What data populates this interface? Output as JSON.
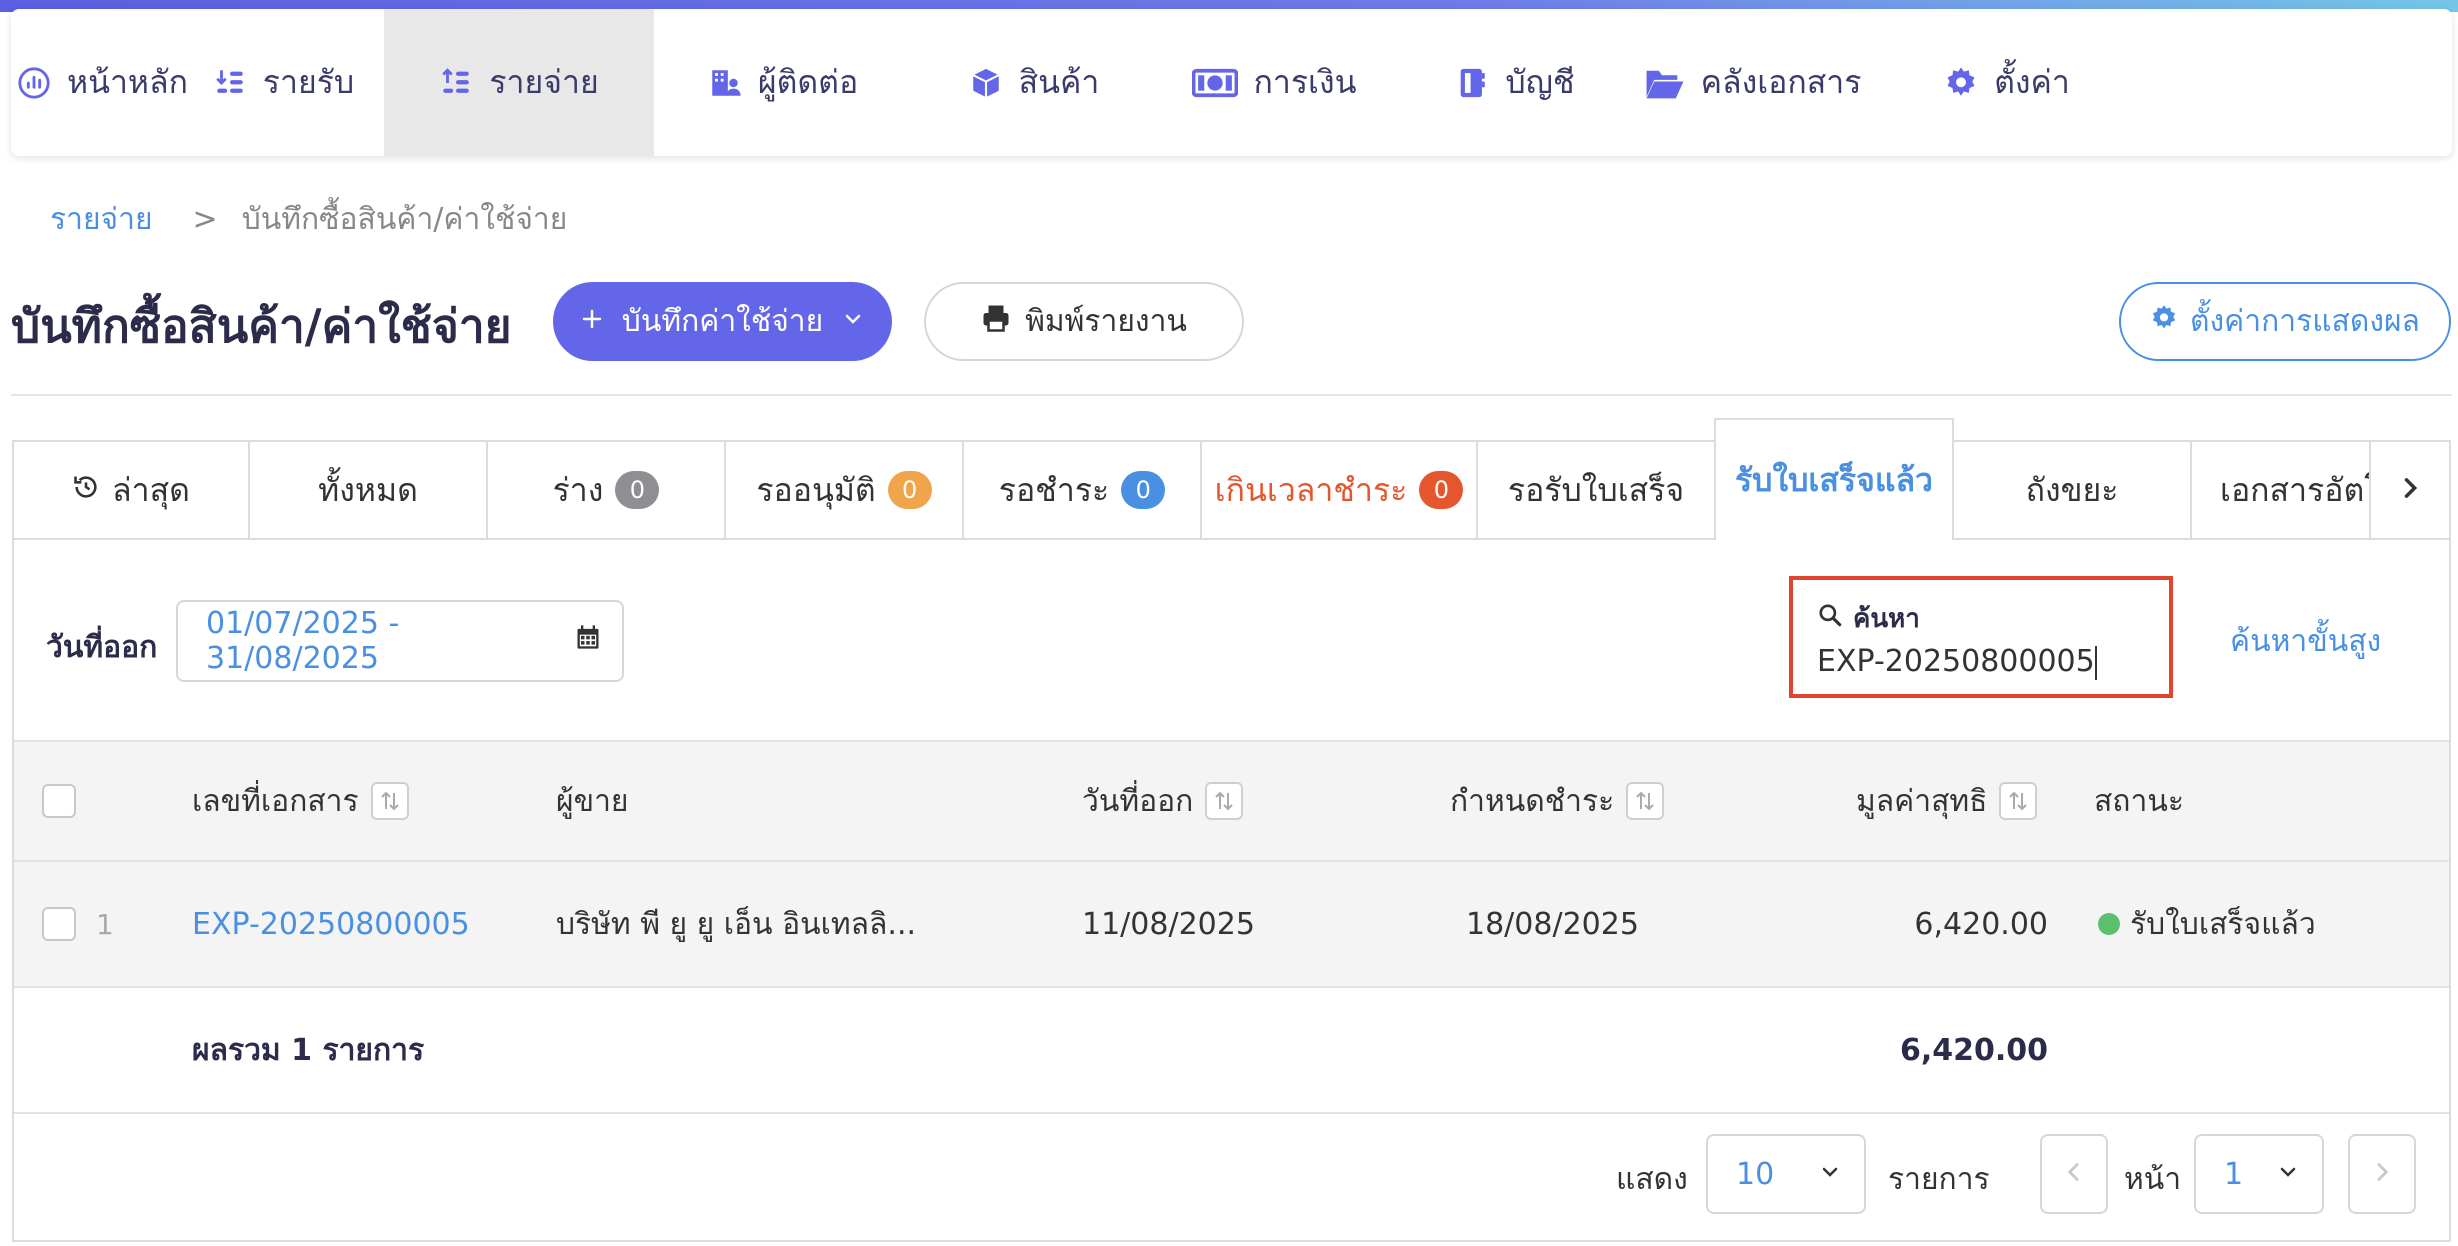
{
  "nav": {
    "items": [
      {
        "label": "หน้าหลัก",
        "icon": "dashboard-icon"
      },
      {
        "label": "รายรับ",
        "icon": "income-icon"
      },
      {
        "label": "รายจ่าย",
        "icon": "expense-icon"
      },
      {
        "label": "ผู้ติดต่อ",
        "icon": "contacts-icon"
      },
      {
        "label": "สินค้า",
        "icon": "box-icon"
      },
      {
        "label": "การเงิน",
        "icon": "money-icon"
      },
      {
        "label": "บัญชี",
        "icon": "ledger-icon"
      },
      {
        "label": "คลังเอกสาร",
        "icon": "folder-icon"
      },
      {
        "label": "ตั้งค่า",
        "icon": "gear-icon"
      }
    ],
    "active_index": 2
  },
  "breadcrumb": {
    "parent": "รายจ่าย",
    "separator": ">",
    "current": "บันทึกซื้อสินค้า/ค่าใช้จ่าย"
  },
  "page": {
    "title": "บันทึกซื้อสินค้า/ค่าใช้จ่าย",
    "add_button": "บันทึกค่าใช้จ่าย",
    "print_button": "พิมพ์รายงาน",
    "display_settings_button": "ตั้งค่าการแสดงผล"
  },
  "tabs": [
    {
      "label": "ล่าสุด"
    },
    {
      "label": "ทั้งหมด"
    },
    {
      "label": "ร่าง",
      "count": "0",
      "badge_color": "#8e8e93"
    },
    {
      "label": "รออนุมัติ",
      "count": "0",
      "badge_color": "#f0a54a"
    },
    {
      "label": "รอชำระ",
      "count": "0",
      "badge_color": "#4a90e2"
    },
    {
      "label": "เกินเวลาชำระ",
      "count": "0",
      "badge_color": "#e4572e"
    },
    {
      "label": "รอรับใบเสร็จ"
    },
    {
      "label": "รับใบเสร็จแล้ว"
    },
    {
      "label": "ถังขยะ"
    },
    {
      "label": "เอกสารอัตโนมัติ"
    }
  ],
  "filters": {
    "date_label": "วันที่ออก",
    "date_range": "01/07/2025 - 31/08/2025",
    "search_label": "ค้นหา",
    "search_value": "EXP-20250800005",
    "advanced_search": "ค้นหาขั้นสูง"
  },
  "table": {
    "headers": {
      "doc_no": "เลขที่เอกสาร",
      "vendor": "ผู้ขาย",
      "issue_date": "วันที่ออก",
      "due_date": "กำหนดชำระ",
      "net_value": "มูลค่าสุทธิ",
      "status": "สถานะ"
    },
    "rows": [
      {
        "index": "1",
        "doc_no": "EXP-20250800005",
        "vendor": "บริษัท พี ยู ยู เอ็น อินเทลลิ...",
        "issue_date": "11/08/2025",
        "due_date": "18/08/2025",
        "net_value": "6,420.00",
        "status": "รับใบเสร็จแล้ว",
        "status_color": "#5cbf6e"
      }
    ],
    "footer": {
      "label": "ผลรวม 1 รายการ",
      "total": "6,420.00"
    }
  },
  "pagination": {
    "show_label": "แสดง",
    "page_size": "10",
    "items_label": "รายการ",
    "page_label": "หน้า",
    "page": "1"
  },
  "colors": {
    "accent": "#6366e8",
    "link": "#4a90e2",
    "highlight_border": "#e0452d"
  }
}
